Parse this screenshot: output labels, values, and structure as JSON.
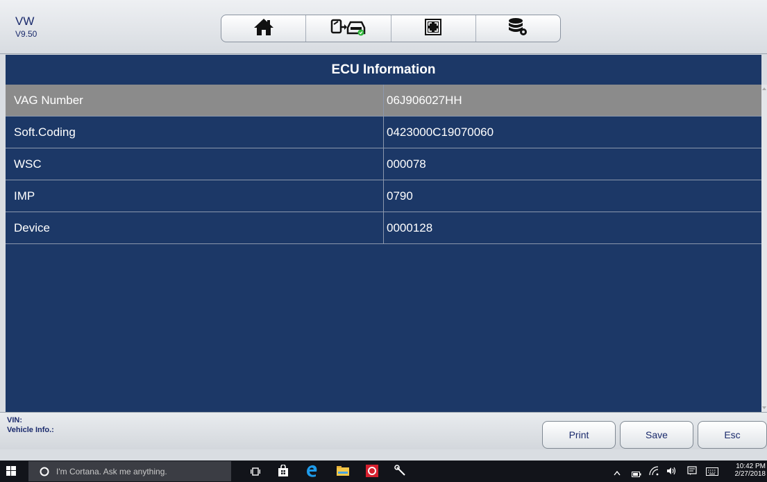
{
  "app": {
    "brand": "VW",
    "version": "V9.50"
  },
  "toolbar": {
    "buttons": [
      {
        "icon": "home-icon"
      },
      {
        "icon": "tablet-car-connect-icon"
      },
      {
        "icon": "fullscreen-icon"
      },
      {
        "icon": "database-settings-icon"
      }
    ]
  },
  "page": {
    "title": "ECU Information"
  },
  "table": {
    "rows": [
      {
        "name": "VAG Number",
        "value": "06J906027HH",
        "selected": true
      },
      {
        "name": "Soft.Coding",
        "value": "0423000C19070060",
        "selected": false
      },
      {
        "name": "WSC",
        "value": "000078",
        "selected": false
      },
      {
        "name": "IMP",
        "value": "0790",
        "selected": false
      },
      {
        "name": "Device",
        "value": "0000128",
        "selected": false
      }
    ]
  },
  "footer": {
    "vin_label": "VIN:",
    "vehicle_info_label": "Vehicle Info.:",
    "print_label": "Print",
    "save_label": "Save",
    "esc_label": "Esc"
  },
  "taskbar": {
    "search_placeholder": "I'm Cortana. Ask me anything.",
    "time": "10:42 PM",
    "date": "2/27/2018"
  },
  "colors": {
    "panel_bg": "#1c3867",
    "selected_row": "#8b8b8b",
    "accent_text": "#1a2a6c"
  }
}
